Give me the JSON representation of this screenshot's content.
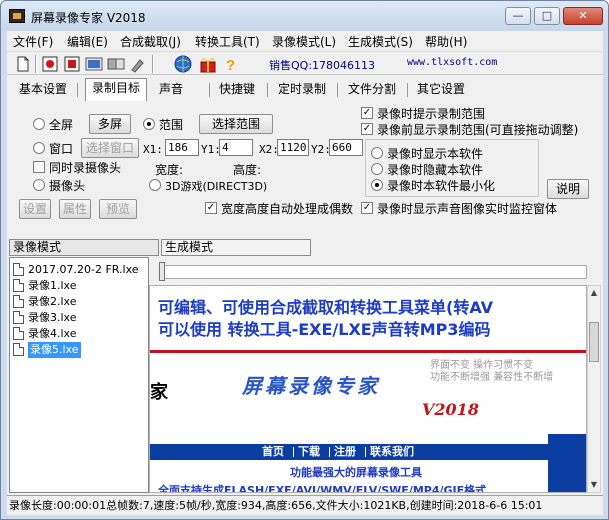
{
  "window": {
    "title": "屏幕录像专家 V2018",
    "buttons": {
      "minimize": "—",
      "maximize": "□",
      "close": "✕"
    }
  },
  "menu": [
    "文件(F)",
    "编辑(E)",
    "合成截取(J)",
    "转换工具(T)",
    "录像模式(L)",
    "生成模式(S)",
    "帮助(H)"
  ],
  "toolbar": {
    "icons": [
      "new-file-icon",
      "record-icon",
      "screen-select-icon",
      "video-icon",
      "convert-icon",
      "brush-icon",
      "globe-icon",
      "gift-icon",
      "help-icon"
    ],
    "sales": "销售QQ:178046113",
    "website": "www.tlxsoft.com"
  },
  "tabs": [
    "基本设置",
    "录制目标",
    "声音",
    "快捷键",
    "定时录制",
    "文件分割",
    "其它设置"
  ],
  "selected_tab": "录制目标",
  "target": {
    "fullscreen": "全屏",
    "multiscreen_button": "多屏",
    "range": "范围",
    "select_range_button": "选择范围",
    "window": "窗口",
    "select_window_button": "选择窗口",
    "also_record_camera": "同时录摄像头",
    "camera": "摄像头",
    "settings_button": "设置",
    "properties_button": "属性",
    "preview_button": "预览",
    "x1_label": "X1:",
    "x1": "186",
    "y1_label": "Y1:",
    "y1": "4",
    "x2_label": "X2:",
    "x2": "1120",
    "y2_label": "Y2:",
    "y2": "660",
    "width_label": "宽度:",
    "height_label": "高度:",
    "game_3d": "3D游戏(DIRECT3D)",
    "auto_even": "宽度高度自动处理成偶数"
  },
  "options": {
    "hint_range": "录像时提示录制范围",
    "show_range_before": "录像前显示录制范围(可直接拖动调整)",
    "show_software": "录像时显示本软件",
    "hide_software": "录像时隐藏本软件",
    "minimize_software": "录像时本软件最小化",
    "explain_button": "说明",
    "monitor_window": "录像时显示声音图像实时监控窗体"
  },
  "sections": {
    "record_mode": "录像模式",
    "generate_mode": "生成模式"
  },
  "files": [
    {
      "name": "2017.07.20-2 FR.lxe",
      "selected": false
    },
    {
      "name": "录像1.lxe",
      "selected": false
    },
    {
      "name": "录像2.lxe",
      "selected": false
    },
    {
      "name": "录像3.lxe",
      "selected": false
    },
    {
      "name": "录像4.lxe",
      "selected": false
    },
    {
      "name": "录像5.lxe",
      "selected": true
    }
  ],
  "preview": {
    "line1": "可编辑、可使用合成截取和转换工具菜单(转AV",
    "line2": "可以使用 转换工具-EXE/LXE声音转MP3编码",
    "ghost1": "界面不变  操作习惯不变",
    "ghost2": "功能不断增强  兼容性不断增",
    "cut_char": "家",
    "logo": "屏幕录像专家",
    "logo_version": "V2018",
    "nav": [
      "首页",
      "下载",
      "注册",
      "联系我们"
    ],
    "tagline": "功能最强大的屏幕录像工具",
    "formats": "全面支持生成FLASH/EXE/AVI/WMV/FLV/SWF/MP4/GIF格式"
  },
  "status": "录像长度:00:00:01总帧数:7,速度:5帧/秒,宽度:934,高度:656,文件大小:1021KB,创建时间:2018-6-6 15:01"
}
